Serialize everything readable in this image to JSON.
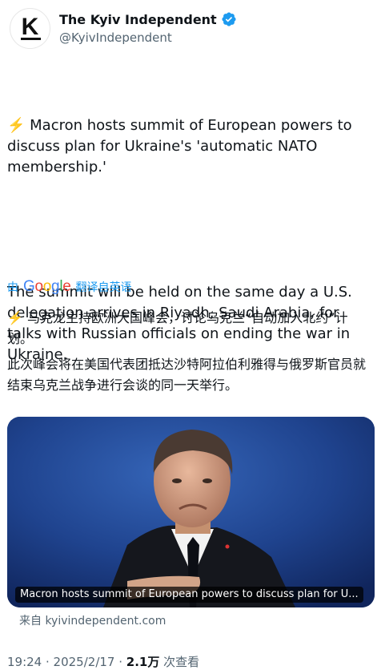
{
  "author": {
    "avatar_letter": "K",
    "display_name": "The Kyiv Independent",
    "handle": "@KyivIndependent",
    "verified": true
  },
  "tweet": {
    "paragraph_1": "⚡️ Macron hosts summit of European powers to discuss plan for Ukraine's 'automatic NATO membership.'",
    "paragraph_2": "The summit will be held on the same day a U.S. delegation arrives in Riyadh, Saudi Arabia, for talks with Russian officials on ending the war in Ukraine."
  },
  "translation": {
    "by_label": "由",
    "google_word": "Google",
    "action_label": "翻译自英语",
    "paragraph_1": "⚡️ 马克龙主持欧洲大国峰会，讨论乌克兰“自动加入北约”计划。",
    "paragraph_2": "此次峰会将在美国代表团抵达沙特阿拉伯利雅得与俄罗斯官员就结束乌克兰战争进行会谈的同一天举行。"
  },
  "link_card": {
    "caption": "Macron hosts summit of European powers to discuss plan for U...",
    "source": "来自 kyivindependent.com"
  },
  "meta": {
    "time": "19:24",
    "sep1": " · ",
    "date": "2025/2/17",
    "sep2": " · ",
    "views_count": "2.1万",
    "views_label": " 次查看"
  },
  "colors": {
    "verified_blue": "#1d9bf0",
    "text": "#0f1419",
    "secondary": "#536471",
    "google_blue": "#4285f4",
    "google_red": "#ea4335",
    "google_yellow": "#fbbc05",
    "google_green": "#34a853"
  }
}
